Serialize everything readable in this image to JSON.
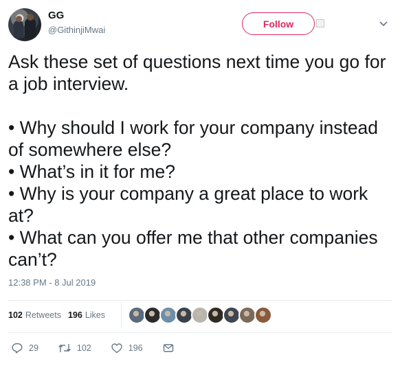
{
  "author": {
    "name": "GG",
    "handle": "@GithinjiMwai"
  },
  "follow_label": "Follow",
  "tweet_text": "Ask these set of questions next time you go for a job interview.\n\n• Why should I work for your company instead of somewhere else?\n• What’s in it for me?\n• Why is your company a great place to work at?\n• What can you offer me that other companies can’t?",
  "timestamp": "12:38 PM - 8 Jul 2019",
  "stats": {
    "retweets_count": "102",
    "retweets_label": "Retweets",
    "likes_count": "196",
    "likes_label": "Likes"
  },
  "liker_avatar_colors": [
    "#5a6b7c",
    "#2b2b2b",
    "#6d8fa8",
    "#38404a",
    "#b8b4ae",
    "#2f2a24",
    "#3e4650",
    "#7c6a58",
    "#8a5a3c"
  ],
  "actions": {
    "reply_count": "29",
    "retweet_count": "102",
    "like_count": "196"
  },
  "colors": {
    "follow": "#e0245e",
    "secondary_text": "#657786"
  }
}
